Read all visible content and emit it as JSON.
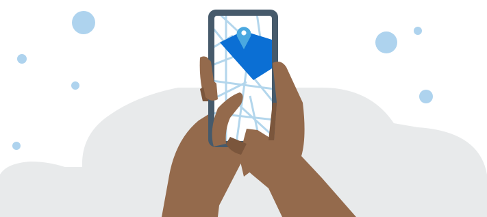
{
  "illustration": {
    "subject": "hands-holding-phone-with-map",
    "icons": {
      "location_pin": "map-pin-icon"
    },
    "colors": {
      "background": "#ffffff",
      "cloud": "#e8eaeb",
      "bubble": "#aed3ee",
      "phone_frame": "#465a6b",
      "screen": "#ffffff",
      "map_roads": "#b3d6ec",
      "map_highlight": "#0b6fd4",
      "pin": "#4aa8e0",
      "skin": "#946a4c",
      "skin_shadow": "#7b563c"
    }
  }
}
